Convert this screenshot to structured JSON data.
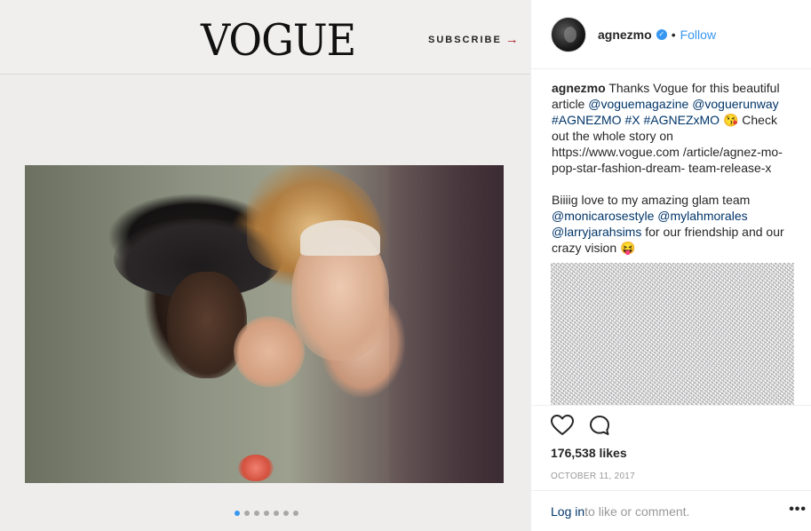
{
  "media": {
    "logo": "VOGUE",
    "subscribe_label": "SUBSCRIBE",
    "subscribe_arrow": "→",
    "carousel_count": 7,
    "carousel_active": 0
  },
  "post": {
    "username": "agnezmo",
    "verified_icon": "✓",
    "separator": "•",
    "follow_label": "Follow",
    "caption": {
      "username": "agnezmo",
      "p1_text1": " Thanks Vogue for this beautiful article ",
      "p1_tag1": "@voguemagazine",
      "p1_space1": " ",
      "p1_tag2": "@voguerunway",
      "p1_space2": " ",
      "p1_tag3": "#AGNEZMO",
      "p1_space3": " ",
      "p1_tag4": "#X",
      "p1_space4": " ",
      "p1_tag5": "#AGNEZxMO",
      "p1_emoji": " 😘",
      "p1_text2": " Check out the whole story on https://www.vogue.com /article/agnez-mo-pop-star-fashion-dream- team-release-x",
      "p2_text1": "Biiiig love to my amazing glam team ",
      "p2_tag1": "@monicarosestyle",
      "p2_space1": " ",
      "p2_tag2": "@mylahmorales",
      "p2_space2": " ",
      "p2_tag3": "@larryjarahsims",
      "p2_text2": " for our friendship and our crazy vision ",
      "p2_emoji": "😝"
    },
    "likes": "176,538 likes",
    "date": "OCTOBER 11, 2017",
    "login_label": "Log in",
    "comment_suffix": " to like or comment.",
    "more_label": "•••"
  },
  "colors": {
    "link_blue": "#3897f0",
    "tag_dark_blue": "#003569",
    "subscribe_red": "#b0212b"
  },
  "icons": [
    "heart-icon",
    "comment-icon",
    "verified-badge-icon",
    "arrow-right-icon",
    "more-icon"
  ]
}
